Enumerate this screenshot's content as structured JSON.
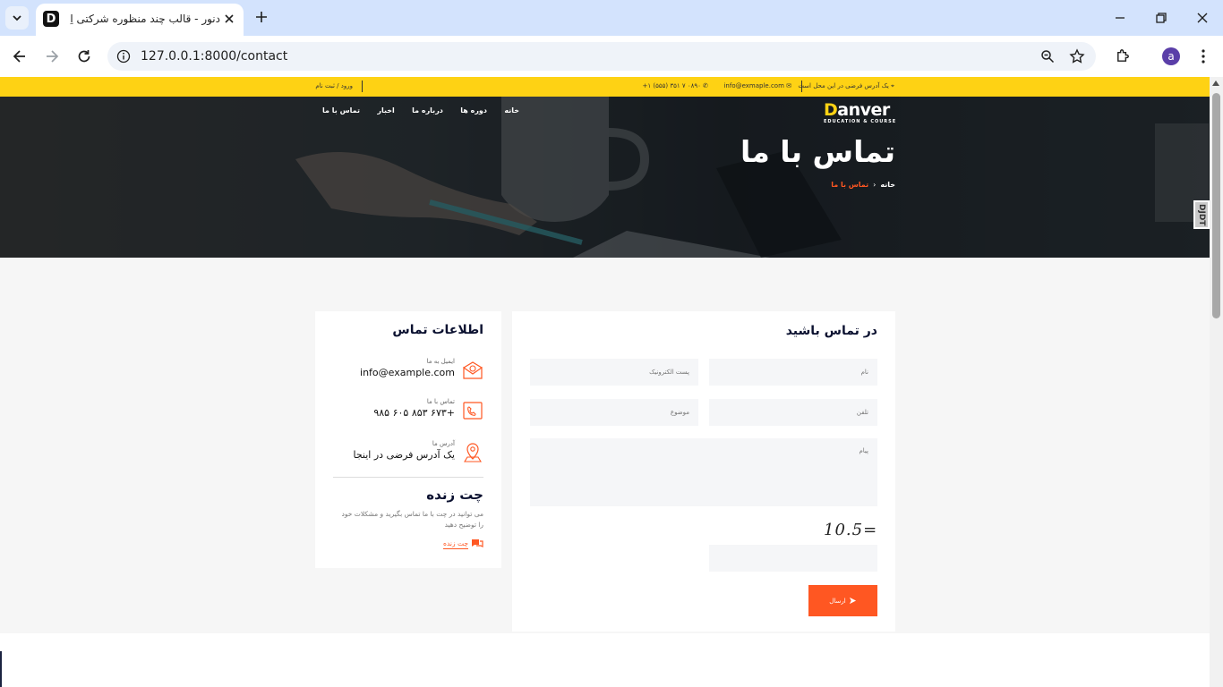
{
  "browser": {
    "tab_title": "دنور - قالب چند منظوره شرکتی اِ",
    "url": "127.0.0.1:8000/contact",
    "avatar_letter": "a",
    "favicon_letter": "D"
  },
  "topbar": {
    "address": "یک آدرس فرضی در این محل است",
    "email": "info@exmaple.com",
    "phone": "۰۸۹۰ ۷ ۳۵۱ (۵۵۵) ۱+",
    "login": "ورود / ثبت نام"
  },
  "header": {
    "logo_main": "anver",
    "logo_initial": "D",
    "logo_sub": "EDUCATION & COURSE",
    "menu": [
      "خانه",
      "دوره ها",
      "درباره ما",
      "اخبار",
      "تماس با ما"
    ],
    "page_title": "تماس با ما",
    "breadcrumb_home": "خانه",
    "breadcrumb_current": "تماس با ما",
    "side_badge": "DJDT"
  },
  "contact_info": {
    "title": "اطلاعات تماس",
    "email_label": "ایمیل به ما",
    "email_value": "info@example.com",
    "phone_label": "تماس با ما",
    "phone_value": "+۶۷۳ ۸۵۳ ۶۰۵ ۹۸۵",
    "address_label": "آدرس ما",
    "address_value": "یک آدرس فرضی در اینجا",
    "chat_title": "چت زنده",
    "chat_desc": "می توانید در چت با ما تماس بگیرید و مشکلات خود را توضیح دهید",
    "chat_link": "چت زنده"
  },
  "form": {
    "title": "در تماس باشید",
    "name_placeholder": "نام",
    "email_placeholder": "پست الکترونیک",
    "phone_placeholder": "تلفن",
    "subject_placeholder": "موضوع",
    "message_placeholder": "پیام",
    "captcha_text": "10.5=",
    "submit_label": "ارسال"
  },
  "colors": {
    "accent": "#ff5722",
    "topbar": "#fed214",
    "heading": "#0b1130"
  }
}
